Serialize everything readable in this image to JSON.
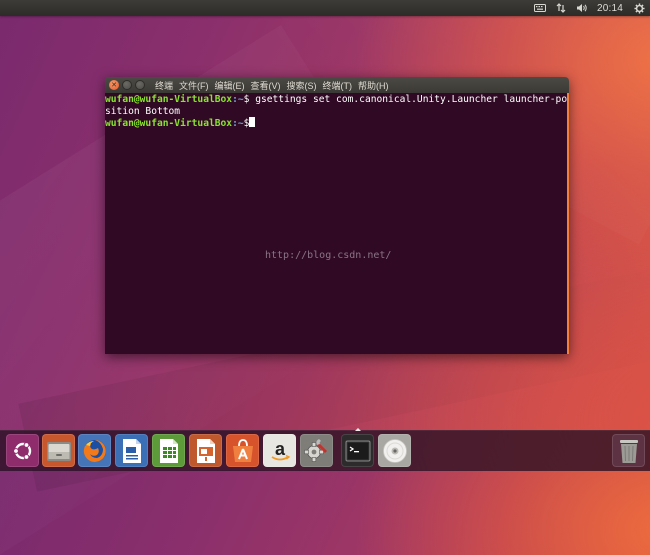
{
  "panel": {
    "clock": "20:14",
    "icons": [
      "keyboard-icon",
      "network-icon",
      "volume-icon",
      "settings-gear-icon"
    ]
  },
  "terminal": {
    "menus": [
      {
        "label": "终端"
      },
      {
        "label": "文件(F)"
      },
      {
        "label": "编辑(E)"
      },
      {
        "label": "查看(V)"
      },
      {
        "label": "搜索(S)"
      },
      {
        "label": "终端(T)"
      },
      {
        "label": "帮助(H)"
      }
    ],
    "prompt_user": "wufan@wufan-VirtualBox",
    "prompt_path": ":~",
    "prompt_symbol": "$",
    "command_part1": " gsettings set com.canonical.Unity.Launcher launcher-po",
    "command_part2": "sition Bottom",
    "watermark": "http://blog.csdn.net/",
    "colors": {
      "background": "#300a24",
      "prompt_user": "#8ae234",
      "prompt_path": "#729fcf"
    }
  },
  "launcher": {
    "items": [
      {
        "name": "ubuntu-dash-icon"
      },
      {
        "name": "files-icon"
      },
      {
        "name": "firefox-icon"
      },
      {
        "name": "libreoffice-writer-icon"
      },
      {
        "name": "libreoffice-calc-icon"
      },
      {
        "name": "libreoffice-impress-icon"
      },
      {
        "name": "software-center-icon"
      },
      {
        "name": "amazon-icon"
      },
      {
        "name": "system-settings-icon"
      },
      {
        "name": "terminal-icon"
      },
      {
        "name": "dvd-icon"
      },
      {
        "name": "trash-icon"
      }
    ],
    "letters": {
      "amazon": "a"
    }
  }
}
